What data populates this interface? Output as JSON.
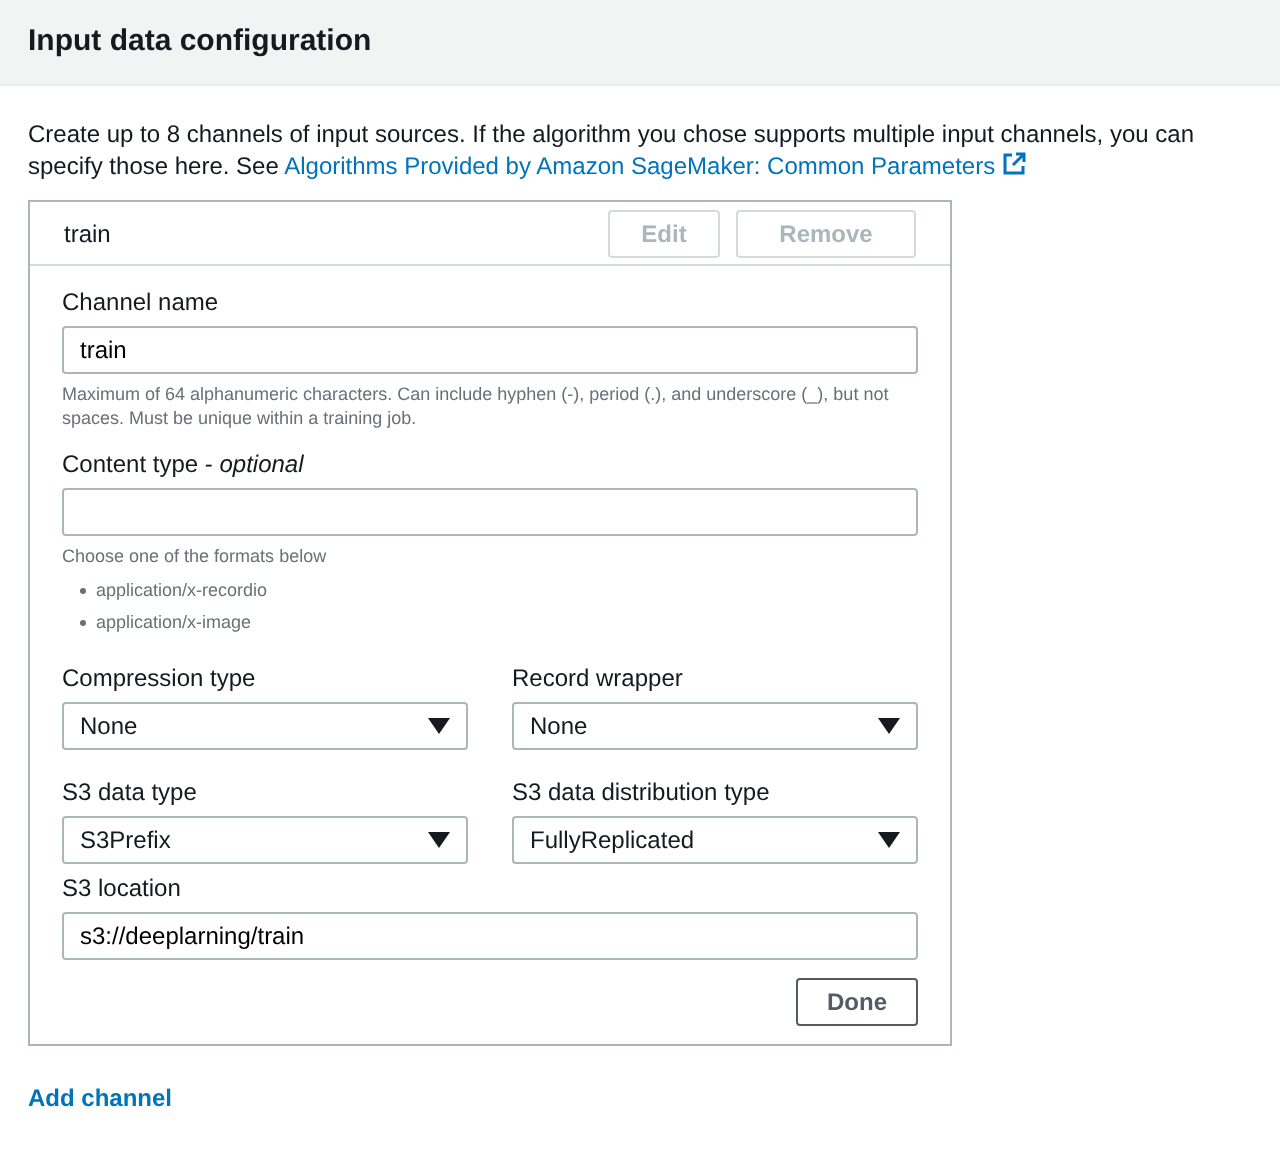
{
  "header": {
    "title": "Input data configuration"
  },
  "intro": {
    "text": "Create up to 8 channels of input sources. If the algorithm you chose supports multiple input channels, you can specify those here. See",
    "link": "Algorithms Provided by Amazon SageMaker: Common Parameters"
  },
  "channel": {
    "name": "train",
    "buttons": [
      {
        "label": "Edit",
        "disabled": true
      },
      {
        "label": "Remove",
        "disabled": true
      }
    ],
    "channel_name": {
      "label": "Channel name",
      "value": "train",
      "hint": "Maximum of 64 alphanumeric characters. Can include hyphen (-), period (.), and underscore (_), but not spaces. Must be unique within a training job."
    },
    "content_type": {
      "label": "Content type - *optional*",
      "hint": "Choose one of the formats below",
      "formats": [
        "application/x-recordio",
        "application/x-image"
      ]
    },
    "selects": [
      {
        "label": "Compression type",
        "value": "None"
      },
      {
        "label": "Record wrapper",
        "value": "None"
      },
      {
        "label": "S3 data type",
        "value": "S3Prefix"
      },
      {
        "label": "S3 data distribution type",
        "value": "FullyReplicated"
      }
    ],
    "s3_location": {
      "label": "S3 location",
      "value": "s3://deeplarning/train"
    },
    "done_button": "Done"
  },
  "add_channel": "Add channel"
}
